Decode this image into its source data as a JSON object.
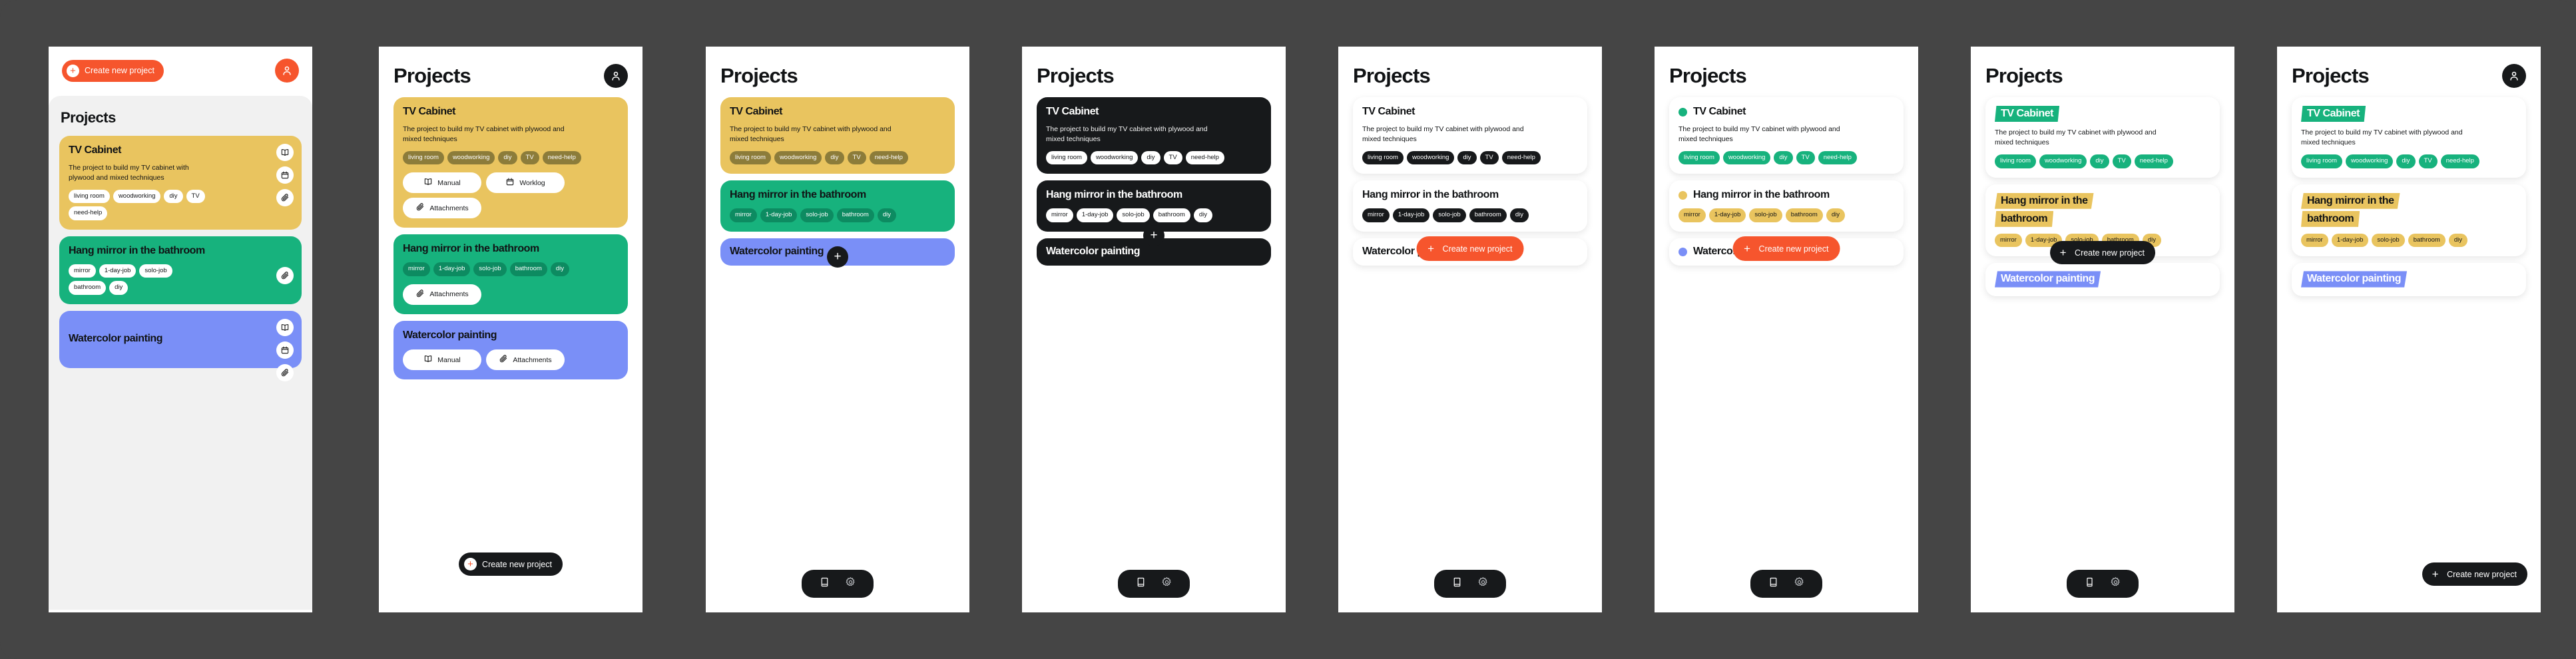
{
  "background_color": "#454545",
  "palette": {
    "orange": "#f6552d",
    "black": "#17191b",
    "yellow": "#edc css",
    "yellow_card": "#e9c45f",
    "green_card": "#17b27d",
    "blue_card": "#7a8ff7",
    "grey_canvas": "#f1f1f1",
    "olive_tag": "#8c7c3a",
    "green_tag": "#0f8f63"
  },
  "labels": {
    "section_title": "Projects",
    "create_new_project": "Create new project",
    "plus": "+",
    "manual": "Manual",
    "worklog": "Worklog",
    "attachments": "Attachments"
  },
  "projects": [
    {
      "id": "tv-cabinet",
      "title": "TV Cabinet",
      "description": "The project to build my TV cabinet with plywood and mixed techniques",
      "description_narrow": "The project to build my TV cabinet with plywood and mixed techniques",
      "tags": [
        "living room",
        "woodworking",
        "diy",
        "TV",
        "need-help"
      ],
      "accent": "#e9c45f",
      "dot_color": "#17b27d",
      "highlight_color": "#17b27d",
      "highlight_text_color": "#ffffff",
      "tag_color": "#17b27d",
      "actions": [
        "Manual",
        "Worklog",
        "Attachments"
      ],
      "icons": [
        "book-icon",
        "calendar-icon",
        "paperclip-icon"
      ]
    },
    {
      "id": "hang-mirror",
      "title": "Hang mirror in the bathroom",
      "description": "",
      "tags": [
        "mirror",
        "1-day-job",
        "solo-job",
        "bathroom",
        "diy"
      ],
      "accent": "#17b27d",
      "dot_color": "#e9c45f",
      "highlight_color": "#e9c45f",
      "highlight_text_color": "#111315",
      "tag_color": "#e9c45f",
      "actions": [
        "Attachments"
      ],
      "icons": [
        "paperclip-icon"
      ]
    },
    {
      "id": "watercolor-painting",
      "title": "Watercolor painting",
      "description": "",
      "tags": [],
      "accent": "#7a8ff7",
      "dot_color": "#7a8ff7",
      "highlight_color": "#7a8ff7",
      "highlight_text_color": "#ffffff",
      "tag_color": "#7a8ff7",
      "actions": [
        "Manual",
        "Attachments"
      ],
      "icons": [
        "book-icon",
        "calendar-icon",
        "paperclip-icon"
      ]
    }
  ],
  "panels": [
    {
      "id": "p1",
      "has_topbar_create": true,
      "avatar": "orange",
      "grey_canvas": true,
      "style": "color-cards-iconcol"
    },
    {
      "id": "p2",
      "has_header_title": true,
      "avatar": "dark",
      "style": "color-cards-actions",
      "bottom_button": "black-create"
    },
    {
      "id": "p3",
      "has_header_title": true,
      "avatar": "none",
      "style": "color-cards-tags-only",
      "fab": true,
      "bottomnav": true
    },
    {
      "id": "p4",
      "has_header_title": true,
      "avatar": "none",
      "style": "dark-cards",
      "fab": true,
      "bottomnav": true
    },
    {
      "id": "p5",
      "has_header_title": true,
      "avatar": "none",
      "style": "white-cards-dark-tags",
      "bottom_button": "orange-create",
      "bottomnav": true
    },
    {
      "id": "p6",
      "has_header_title": true,
      "avatar": "none",
      "style": "white-cards-dots",
      "bottom_button": "orange-create",
      "bottomnav": true
    },
    {
      "id": "p7",
      "has_header_title": true,
      "avatar": "none",
      "style": "white-cards-highlight",
      "bottom_button": "black-create",
      "bottomnav": true
    },
    {
      "id": "p8",
      "has_header_title": true,
      "avatar": "dark",
      "style": "white-cards-highlight",
      "bottom_button": "black-create-corner"
    }
  ]
}
